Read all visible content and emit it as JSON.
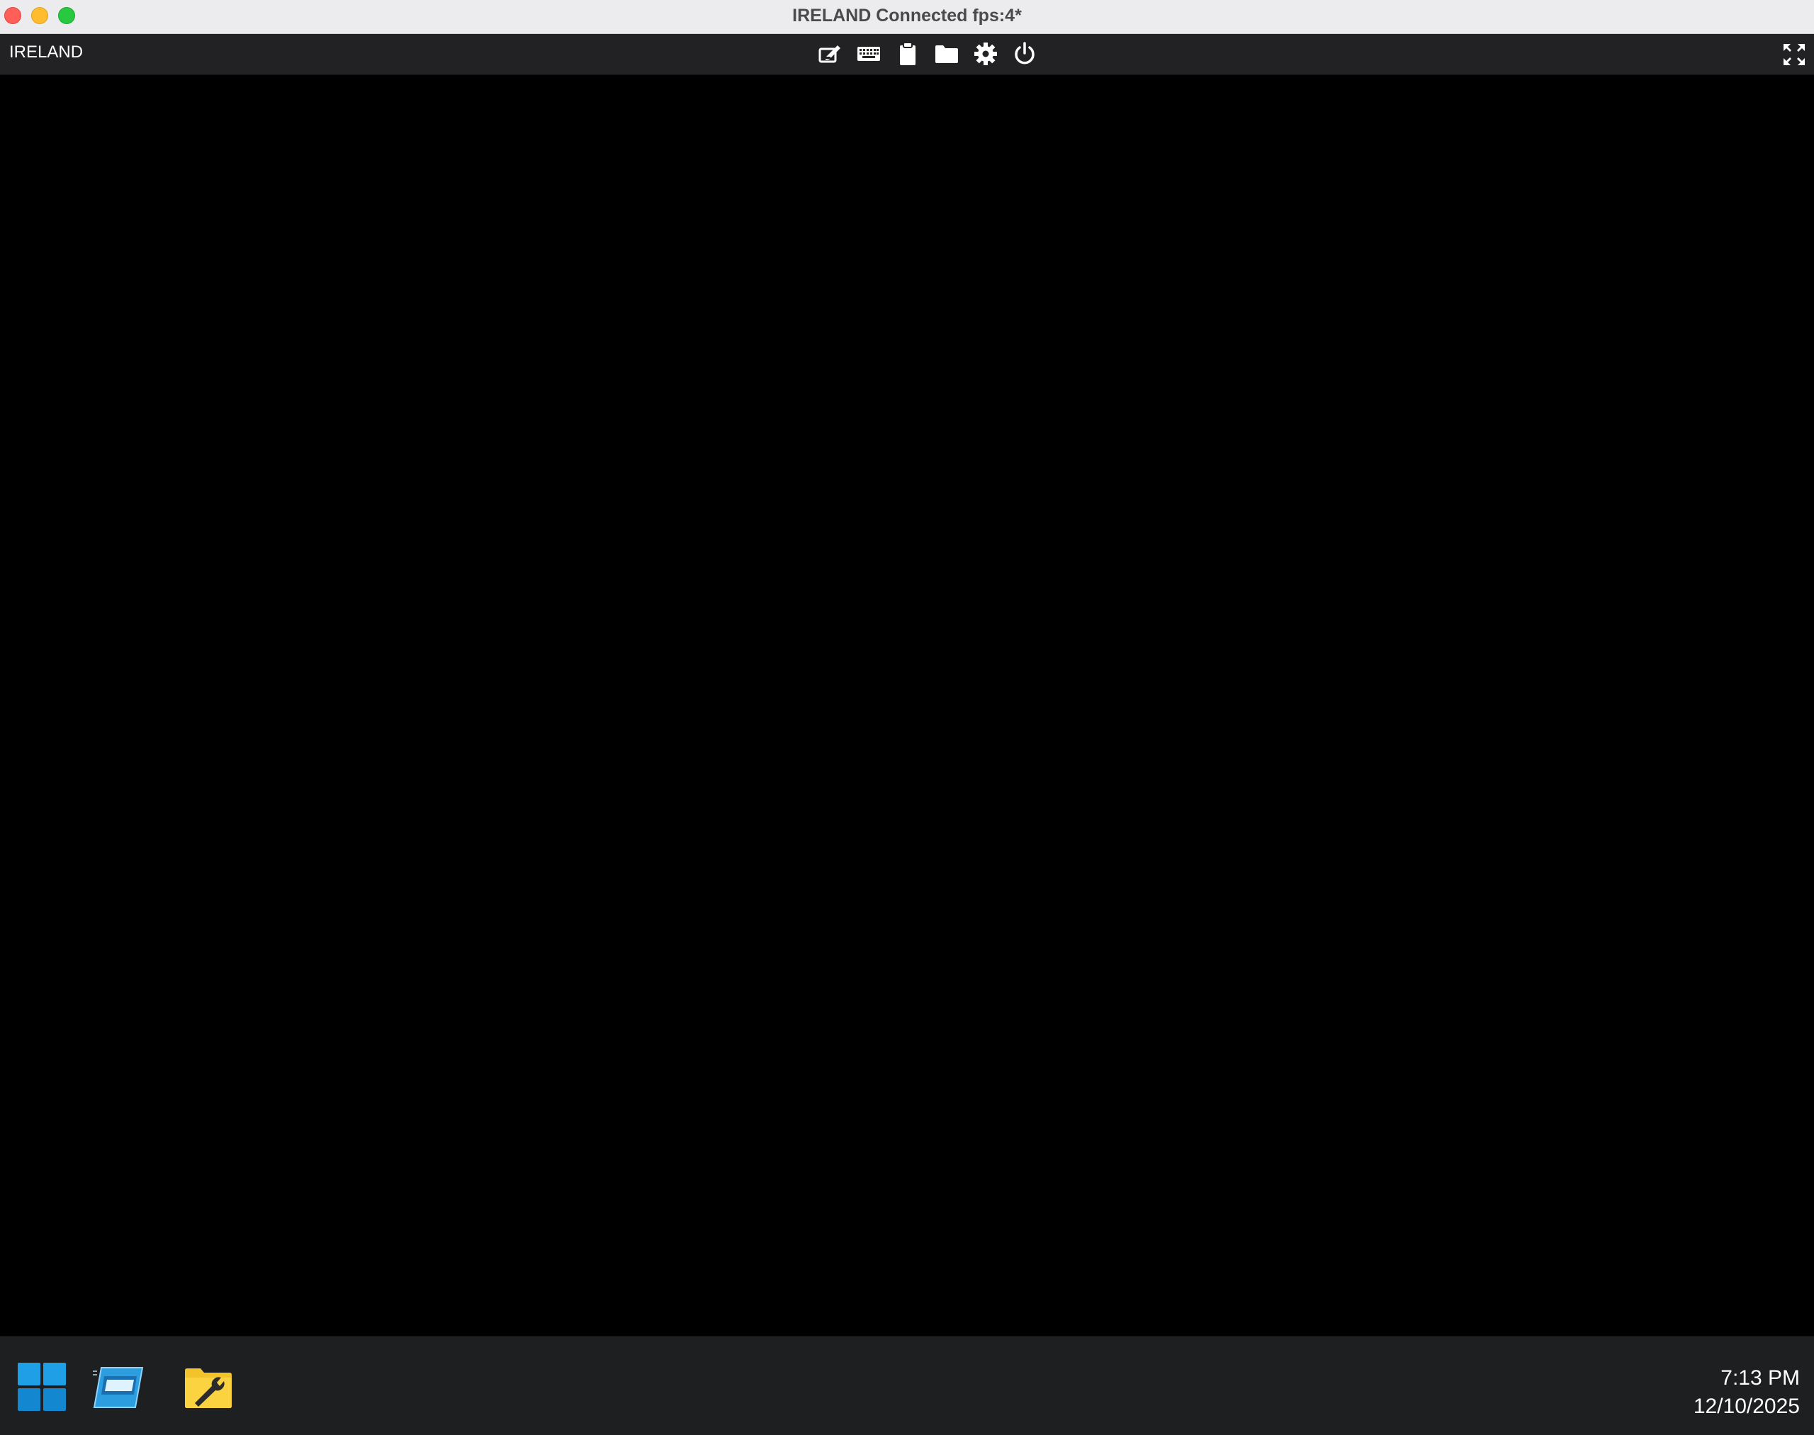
{
  "window": {
    "title": "IRELAND Connected fps:4*"
  },
  "toolbar": {
    "connection_name": "IRELAND",
    "icons": [
      "edit-icon",
      "keyboard-icon",
      "clipboard-icon",
      "folder-icon",
      "gear-icon",
      "power-icon"
    ],
    "fullscreen_icon": "fullscreen-icon",
    "icon_color": "#ffffff",
    "background": "#222224"
  },
  "taskbar": {
    "apps": [
      "windows-start-icon",
      "server-manager-icon",
      "admin-tools-icon"
    ],
    "clock": {
      "time": "7:13 PM",
      "date": "12/10/2025"
    },
    "background": "#1e1f20"
  },
  "colors": {
    "traffic_close": "#ff5f57",
    "traffic_minimize": "#febc2e",
    "traffic_maximize": "#28c840",
    "desktop": "#000000",
    "start_blue": "#1fa0e6",
    "tools_yellow": "#f4c22b"
  }
}
